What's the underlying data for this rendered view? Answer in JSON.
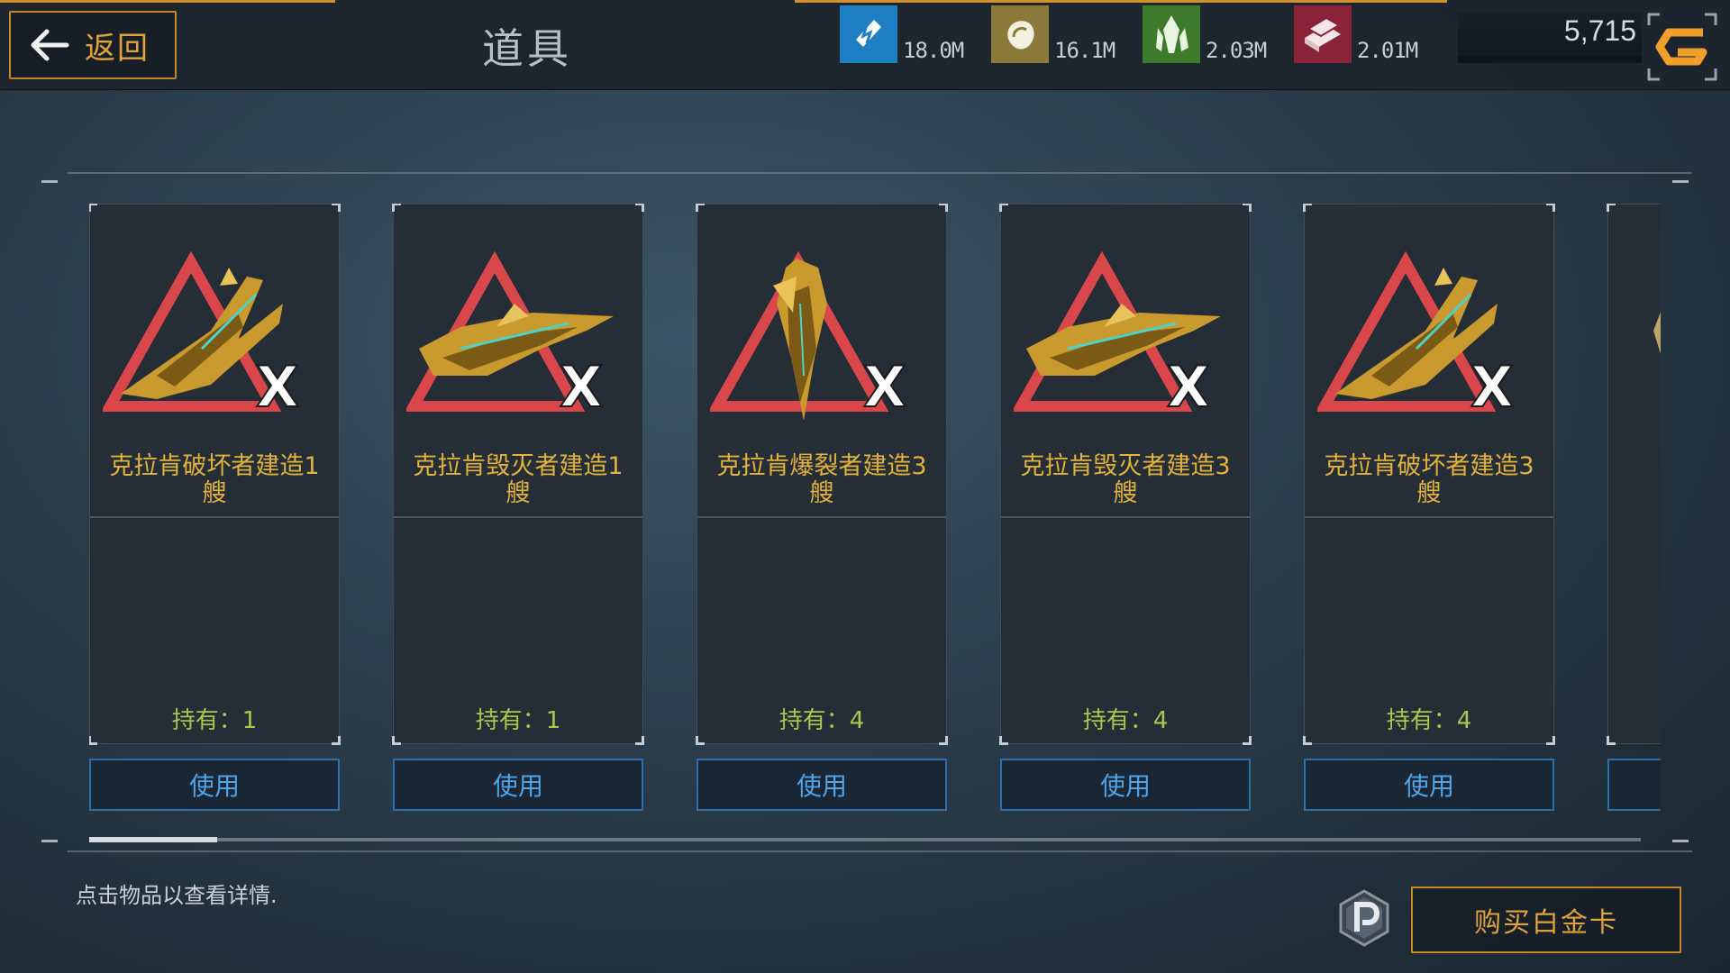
{
  "header": {
    "back_label": "返回",
    "title": "道具",
    "resources": [
      {
        "icon": "energy-icon",
        "value": "18.0M",
        "color": "#1f7fc3"
      },
      {
        "icon": "ore-icon",
        "value": "16.1M",
        "color": "#8a7a3a"
      },
      {
        "icon": "crystal-icon",
        "value": "2.03M",
        "color": "#3e7a2c"
      },
      {
        "icon": "alloy-icon",
        "value": "2.01M",
        "color": "#8a2238"
      }
    ],
    "currency": {
      "value": "5,715",
      "icon": "g-currency-icon"
    }
  },
  "items": [
    {
      "name_line1": "克拉肯破坏者建造1",
      "name_line2": "艘",
      "owned": "持有：1",
      "use_label": "使用",
      "icon": "kraken-wrecker-ship-icon"
    },
    {
      "name_line1": "克拉肯毁灭者建造1",
      "name_line2": "艘",
      "owned": "持有：1",
      "use_label": "使用",
      "icon": "kraken-destroyer-ship-icon"
    },
    {
      "name_line1": "克拉肯爆裂者建造3",
      "name_line2": "艘",
      "owned": "持有：4",
      "use_label": "使用",
      "icon": "kraken-burster-ship-icon"
    },
    {
      "name_line1": "克拉肯毁灭者建造3",
      "name_line2": "艘",
      "owned": "持有：4",
      "use_label": "使用",
      "icon": "kraken-destroyer-ship-icon"
    },
    {
      "name_line1": "克拉肯破坏者建造3",
      "name_line2": "艘",
      "owned": "持有：4",
      "use_label": "使用",
      "icon": "kraken-wrecker-ship-icon"
    }
  ],
  "colors": {
    "accent": "#e0a33b",
    "item_name": "#e3b23a",
    "owned": "#a5c94b",
    "use_text": "#4fa4ea"
  },
  "scroll_position": 0.0,
  "footer": {
    "hint": "点击物品以查看详情.",
    "buy_label": "购买白金卡",
    "platinum_icon": "platinum-p-icon"
  }
}
